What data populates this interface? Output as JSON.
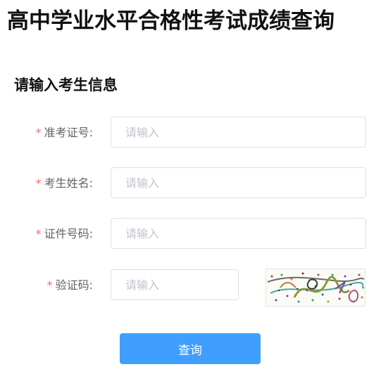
{
  "page": {
    "title": "高中学业水平合格性考试成绩查询",
    "section_title": "请输入考生信息"
  },
  "form": {
    "required_mark": "*",
    "fields": [
      {
        "label": "准考证号:",
        "placeholder": "请输入",
        "value": ""
      },
      {
        "label": "考生姓名:",
        "placeholder": "请输入",
        "value": ""
      },
      {
        "label": "证件号码:",
        "placeholder": "请输入",
        "value": ""
      },
      {
        "label": "验证码:",
        "placeholder": "请输入",
        "value": ""
      }
    ],
    "submit_label": "查询"
  },
  "colors": {
    "primary": "#409eff",
    "required": "#f56c6c",
    "label": "#606266",
    "border": "#dcdfe6",
    "placeholder": "#c0c4cc"
  }
}
